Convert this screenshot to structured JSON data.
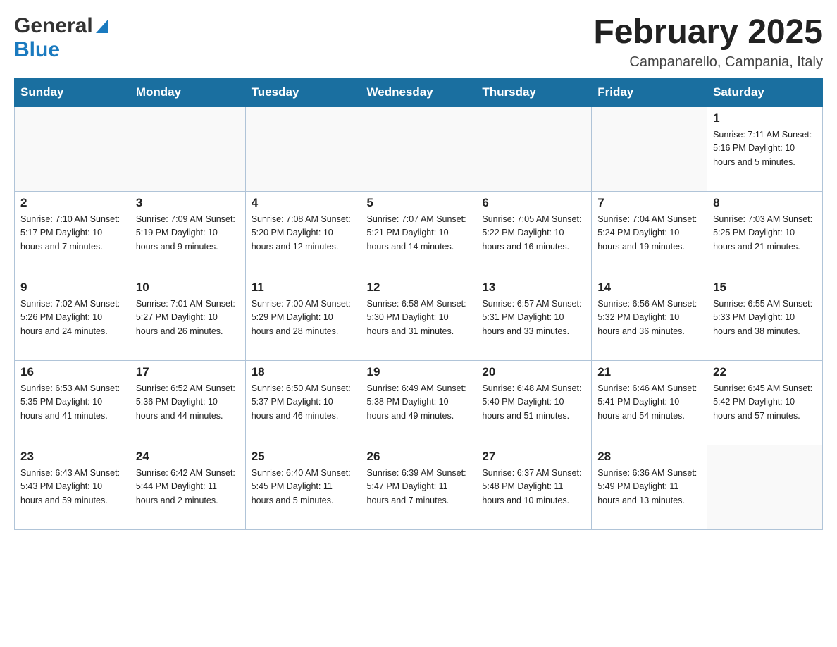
{
  "header": {
    "logo_general": "General",
    "logo_blue": "Blue",
    "title": "February 2025",
    "subtitle": "Campanarello, Campania, Italy"
  },
  "days_of_week": [
    "Sunday",
    "Monday",
    "Tuesday",
    "Wednesday",
    "Thursday",
    "Friday",
    "Saturday"
  ],
  "weeks": [
    [
      {
        "day": "",
        "info": ""
      },
      {
        "day": "",
        "info": ""
      },
      {
        "day": "",
        "info": ""
      },
      {
        "day": "",
        "info": ""
      },
      {
        "day": "",
        "info": ""
      },
      {
        "day": "",
        "info": ""
      },
      {
        "day": "1",
        "info": "Sunrise: 7:11 AM\nSunset: 5:16 PM\nDaylight: 10 hours and 5 minutes."
      }
    ],
    [
      {
        "day": "2",
        "info": "Sunrise: 7:10 AM\nSunset: 5:17 PM\nDaylight: 10 hours and 7 minutes."
      },
      {
        "day": "3",
        "info": "Sunrise: 7:09 AM\nSunset: 5:19 PM\nDaylight: 10 hours and 9 minutes."
      },
      {
        "day": "4",
        "info": "Sunrise: 7:08 AM\nSunset: 5:20 PM\nDaylight: 10 hours and 12 minutes."
      },
      {
        "day": "5",
        "info": "Sunrise: 7:07 AM\nSunset: 5:21 PM\nDaylight: 10 hours and 14 minutes."
      },
      {
        "day": "6",
        "info": "Sunrise: 7:05 AM\nSunset: 5:22 PM\nDaylight: 10 hours and 16 minutes."
      },
      {
        "day": "7",
        "info": "Sunrise: 7:04 AM\nSunset: 5:24 PM\nDaylight: 10 hours and 19 minutes."
      },
      {
        "day": "8",
        "info": "Sunrise: 7:03 AM\nSunset: 5:25 PM\nDaylight: 10 hours and 21 minutes."
      }
    ],
    [
      {
        "day": "9",
        "info": "Sunrise: 7:02 AM\nSunset: 5:26 PM\nDaylight: 10 hours and 24 minutes."
      },
      {
        "day": "10",
        "info": "Sunrise: 7:01 AM\nSunset: 5:27 PM\nDaylight: 10 hours and 26 minutes."
      },
      {
        "day": "11",
        "info": "Sunrise: 7:00 AM\nSunset: 5:29 PM\nDaylight: 10 hours and 28 minutes."
      },
      {
        "day": "12",
        "info": "Sunrise: 6:58 AM\nSunset: 5:30 PM\nDaylight: 10 hours and 31 minutes."
      },
      {
        "day": "13",
        "info": "Sunrise: 6:57 AM\nSunset: 5:31 PM\nDaylight: 10 hours and 33 minutes."
      },
      {
        "day": "14",
        "info": "Sunrise: 6:56 AM\nSunset: 5:32 PM\nDaylight: 10 hours and 36 minutes."
      },
      {
        "day": "15",
        "info": "Sunrise: 6:55 AM\nSunset: 5:33 PM\nDaylight: 10 hours and 38 minutes."
      }
    ],
    [
      {
        "day": "16",
        "info": "Sunrise: 6:53 AM\nSunset: 5:35 PM\nDaylight: 10 hours and 41 minutes."
      },
      {
        "day": "17",
        "info": "Sunrise: 6:52 AM\nSunset: 5:36 PM\nDaylight: 10 hours and 44 minutes."
      },
      {
        "day": "18",
        "info": "Sunrise: 6:50 AM\nSunset: 5:37 PM\nDaylight: 10 hours and 46 minutes."
      },
      {
        "day": "19",
        "info": "Sunrise: 6:49 AM\nSunset: 5:38 PM\nDaylight: 10 hours and 49 minutes."
      },
      {
        "day": "20",
        "info": "Sunrise: 6:48 AM\nSunset: 5:40 PM\nDaylight: 10 hours and 51 minutes."
      },
      {
        "day": "21",
        "info": "Sunrise: 6:46 AM\nSunset: 5:41 PM\nDaylight: 10 hours and 54 minutes."
      },
      {
        "day": "22",
        "info": "Sunrise: 6:45 AM\nSunset: 5:42 PM\nDaylight: 10 hours and 57 minutes."
      }
    ],
    [
      {
        "day": "23",
        "info": "Sunrise: 6:43 AM\nSunset: 5:43 PM\nDaylight: 10 hours and 59 minutes."
      },
      {
        "day": "24",
        "info": "Sunrise: 6:42 AM\nSunset: 5:44 PM\nDaylight: 11 hours and 2 minutes."
      },
      {
        "day": "25",
        "info": "Sunrise: 6:40 AM\nSunset: 5:45 PM\nDaylight: 11 hours and 5 minutes."
      },
      {
        "day": "26",
        "info": "Sunrise: 6:39 AM\nSunset: 5:47 PM\nDaylight: 11 hours and 7 minutes."
      },
      {
        "day": "27",
        "info": "Sunrise: 6:37 AM\nSunset: 5:48 PM\nDaylight: 11 hours and 10 minutes."
      },
      {
        "day": "28",
        "info": "Sunrise: 6:36 AM\nSunset: 5:49 PM\nDaylight: 11 hours and 13 minutes."
      },
      {
        "day": "",
        "info": ""
      }
    ]
  ]
}
